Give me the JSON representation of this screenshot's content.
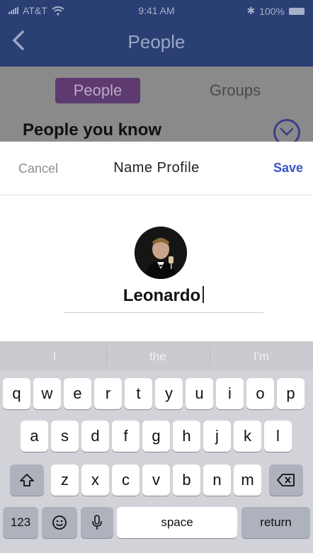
{
  "status": {
    "carrier": "AT&T",
    "time": "9:41 AM",
    "battery": "100%"
  },
  "nav": {
    "title": "People",
    "back_icon": "chevron-left-icon"
  },
  "segments": {
    "people": "People",
    "groups": "Groups"
  },
  "section": {
    "title": "People you know"
  },
  "modal": {
    "cancel": "Cancel",
    "title": "Name Profile",
    "save": "Save",
    "name_value": "Leonardo"
  },
  "keyboard": {
    "suggestions": [
      "I",
      "the",
      "I'm"
    ],
    "row1": [
      "q",
      "w",
      "e",
      "r",
      "t",
      "y",
      "u",
      "i",
      "o",
      "p"
    ],
    "row2": [
      "a",
      "s",
      "d",
      "f",
      "g",
      "h",
      "j",
      "k",
      "l"
    ],
    "row3": [
      "z",
      "x",
      "c",
      "v",
      "b",
      "n",
      "m"
    ],
    "numbers": "123",
    "space": "space",
    "return": "return"
  }
}
